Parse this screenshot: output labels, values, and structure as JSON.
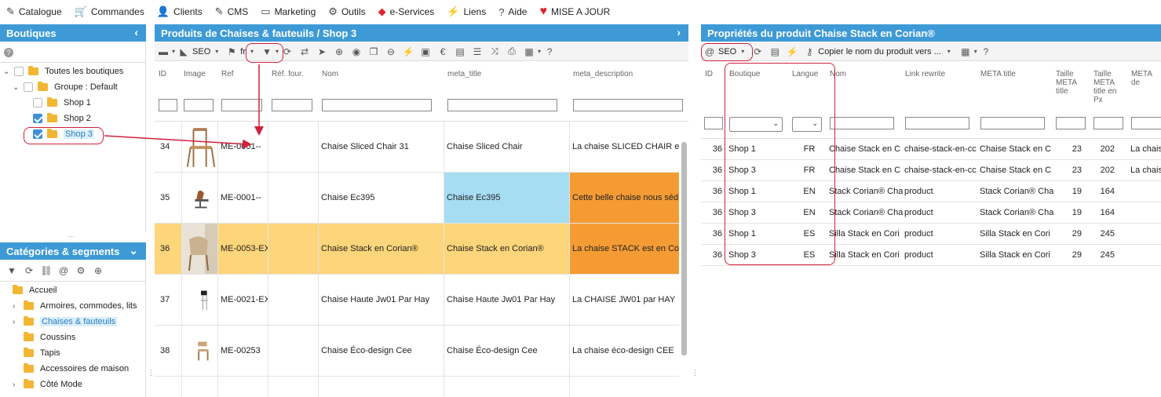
{
  "menu": [
    {
      "icon": "edit-icon",
      "label": "Catalogue"
    },
    {
      "icon": "cart-icon",
      "label": "Commandes"
    },
    {
      "icon": "user-icon",
      "label": "Clients"
    },
    {
      "icon": "edit-icon",
      "label": "CMS"
    },
    {
      "icon": "megaphone-icon",
      "label": "Marketing"
    },
    {
      "icon": "gear-icon",
      "label": "Outils"
    },
    {
      "icon": "gem-icon",
      "label": "e-Services"
    },
    {
      "icon": "bolt-icon",
      "label": "Liens"
    },
    {
      "icon": "help-icon",
      "label": "Aide"
    },
    {
      "icon": "heart-icon",
      "label": "MISE A JOUR"
    }
  ],
  "boutiques": {
    "title": "Boutiques",
    "items": [
      {
        "label": "Toutes les boutiques",
        "checked": false
      },
      {
        "label": "Groupe : Default",
        "checked": false
      },
      {
        "label": "Shop 1",
        "checked": false
      },
      {
        "label": "Shop 2",
        "checked": true
      },
      {
        "label": "Shop 3",
        "checked": true
      }
    ]
  },
  "categories": {
    "title": "Catégories & segments",
    "items": [
      {
        "label": "Accueil"
      },
      {
        "label": "Armoires, commodes, lits"
      },
      {
        "label": "Chaises & fauteuils"
      },
      {
        "label": "Coussins"
      },
      {
        "label": "Tapis"
      },
      {
        "label": "Accessoires de maison"
      },
      {
        "label": "Côté Mode"
      }
    ]
  },
  "products": {
    "title": "Produits de Chaises & fauteuils / Shop 3",
    "view": "SEO",
    "lang": "fr",
    "columns": [
      "ID",
      "Image",
      "Ref",
      "Réf. four.",
      "Nom",
      "meta_title",
      "meta_description"
    ],
    "rows": [
      {
        "id": "34",
        "ref": "ME-0001--",
        "nom": "Chaise Sliced Chair 31",
        "meta_title": "Chaise Sliced Chair",
        "meta_desc": "La chaise SLICED CHAIR e"
      },
      {
        "id": "35",
        "ref": "ME-0001--",
        "nom": "Chaise Ec395",
        "meta_title": "Chaise Ec395",
        "meta_desc": "Cette belle chaise nous séd"
      },
      {
        "id": "36",
        "ref": "ME-0053-EX",
        "nom": "Chaise Stack en Corian®",
        "meta_title": "Chaise Stack en Corian®",
        "meta_desc": "La chaise STACK est en Co"
      },
      {
        "id": "37",
        "ref": "ME-0021-EX",
        "nom": "Chaise Haute Jw01 Par Hay",
        "meta_title": "Chaise Haute Jw01 Par Hay",
        "meta_desc": "La CHAISE JW01 par HAY"
      },
      {
        "id": "38",
        "ref": "ME-00253",
        "nom": "Chaise Éco-design Cee",
        "meta_title": "Chaise Éco-design Cee",
        "meta_desc": "La chaise éco-design CEE"
      }
    ]
  },
  "props": {
    "title": "Propriétés du produit Chaise Stack en Corian®",
    "view": "SEO",
    "copy_label": "Copier le nom du produit vers ...",
    "columns": [
      "ID",
      "Boutique",
      "Langue",
      "Nom",
      "Link rewrite",
      "META title",
      "Taille META title",
      "Taille META title en Px",
      "META de"
    ],
    "rows": [
      {
        "id": "36",
        "shop": "Shop 1",
        "lang": "FR",
        "nom": "Chaise Stack en C",
        "link": "chaise-stack-en-cc",
        "meta": "Chaise Stack en C",
        "size": "23",
        "px": "202",
        "desc": "La chais"
      },
      {
        "id": "36",
        "shop": "Shop 3",
        "lang": "FR",
        "nom": "Chaise Stack en C",
        "link": "chaise-stack-en-cc",
        "meta": "Chaise Stack en C",
        "size": "23",
        "px": "202",
        "desc": "La chais"
      },
      {
        "id": "36",
        "shop": "Shop 1",
        "lang": "EN",
        "nom": "Stack Corian® Cha",
        "link": "product",
        "meta": "Stack Corian® Cha",
        "size": "19",
        "px": "164",
        "desc": ""
      },
      {
        "id": "36",
        "shop": "Shop 3",
        "lang": "EN",
        "nom": "Stack Corian® Cha",
        "link": "product",
        "meta": "Stack Corian® Cha",
        "size": "19",
        "px": "164",
        "desc": ""
      },
      {
        "id": "36",
        "shop": "Shop 1",
        "lang": "ES",
        "nom": "Silla Stack en Cori",
        "link": "product",
        "meta": "Silla Stack en Cori",
        "size": "29",
        "px": "245",
        "desc": ""
      },
      {
        "id": "36",
        "shop": "Shop 3",
        "lang": "ES",
        "nom": "Silla Stack en Cori",
        "link": "product",
        "meta": "Silla Stack en Cori",
        "size": "29",
        "px": "245",
        "desc": ""
      }
    ]
  }
}
